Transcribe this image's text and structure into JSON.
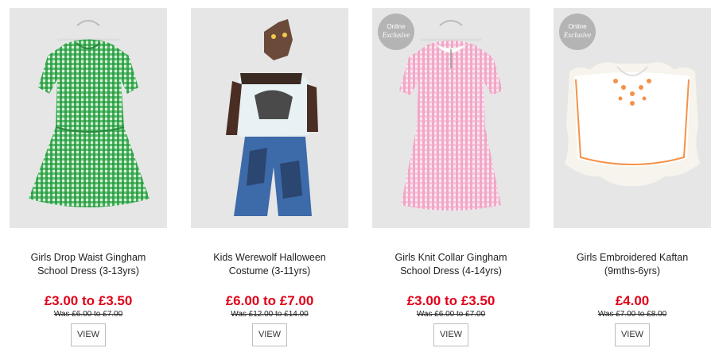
{
  "products": [
    {
      "title_line1": "Girls Drop Waist Gingham",
      "title_line2": "School Dress (3-13yrs)",
      "price": "£3.00 to £3.50",
      "was": "Was £6.00 to £7.00",
      "view_label": "VIEW",
      "image_icon": "green-gingham-dress",
      "badge_line1": "",
      "badge_line2": ""
    },
    {
      "title_line1": "Kids Werewolf Halloween",
      "title_line2": "Costume (3-11yrs)",
      "price": "£6.00 to £7.00",
      "was": "Was £12.00 to £14.00",
      "view_label": "VIEW",
      "image_icon": "werewolf-costume",
      "badge_line1": "",
      "badge_line2": ""
    },
    {
      "title_line1": "Girls Knit Collar Gingham",
      "title_line2": "School Dress (4-14yrs)",
      "price": "£3.00 to £3.50",
      "was": "Was £6.00 to £7.00",
      "view_label": "VIEW",
      "image_icon": "pink-gingham-dress",
      "badge_line1": "Online",
      "badge_line2": "Exclusive"
    },
    {
      "title_line1": "Girls Embroidered Kaftan",
      "title_line2": "(9mths-6yrs)",
      "price": "£4.00",
      "was": "Was £7.00 to £8.00",
      "view_label": "VIEW",
      "image_icon": "embroidered-kaftan",
      "badge_line1": "Online",
      "badge_line2": "Exclusive"
    }
  ],
  "colors": {
    "price_red": "#e00018",
    "image_bg": "#e6e6e6",
    "badge_grey": "#b4b4b4"
  }
}
